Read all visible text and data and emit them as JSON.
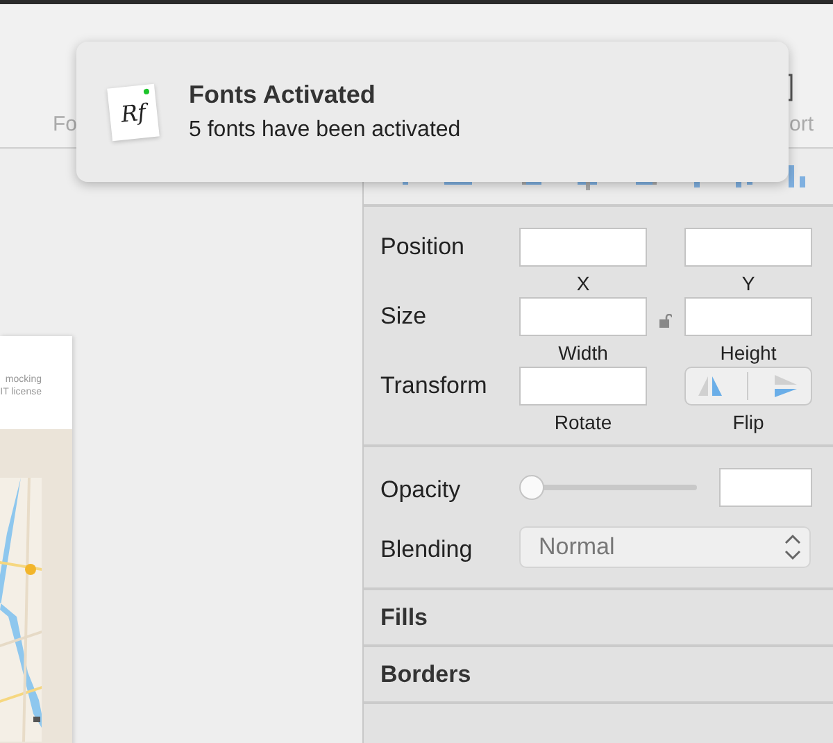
{
  "toolbar": {
    "labels": [
      "Fo",
      "ort"
    ]
  },
  "notification": {
    "app_icon_text": "Rf",
    "title": "Fonts Activated",
    "message": "5 fonts have been activated"
  },
  "artboard": {
    "text_lines": [
      "mocking",
      "IT license"
    ],
    "map": {
      "kind": "picture"
    }
  },
  "inspector": {
    "rows": [
      {
        "label": "Position",
        "lock": false,
        "fields": [
          {
            "kind": "input",
            "caption": "X"
          },
          {
            "kind": "input",
            "caption": "Y"
          }
        ]
      },
      {
        "label": "Size",
        "lock": true,
        "fields": [
          {
            "kind": "input",
            "caption": "Width"
          },
          {
            "kind": "input",
            "caption": "Height"
          }
        ]
      },
      {
        "label": "Transform",
        "lock": false,
        "fields": [
          {
            "kind": "input",
            "caption": "Rotate"
          },
          {
            "kind": "flip",
            "caption": "Flip"
          }
        ]
      }
    ],
    "opacity": {
      "label": "Opacity",
      "level": 0
    },
    "blending": {
      "label": "Blending",
      "value": "Normal"
    },
    "sections": [
      {
        "title": "Fills"
      },
      {
        "title": "Borders"
      }
    ]
  }
}
